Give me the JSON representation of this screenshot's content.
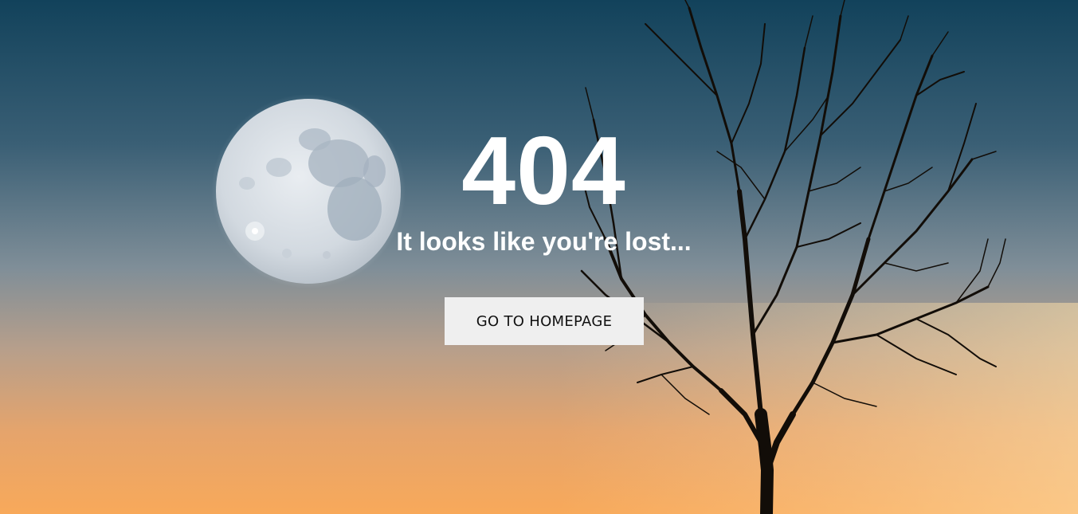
{
  "page": {
    "error_code": "404",
    "message": "It looks like you're lost...",
    "home_button_label": "GO TO HOMEPAGE"
  },
  "background": {
    "sky_top_color": "#16465e",
    "sky_mid_color": "#8f9ba3",
    "sky_bottom_color": "#f9a85c",
    "moon_color": "#dfe3e8",
    "tree_color": "#120d08"
  }
}
